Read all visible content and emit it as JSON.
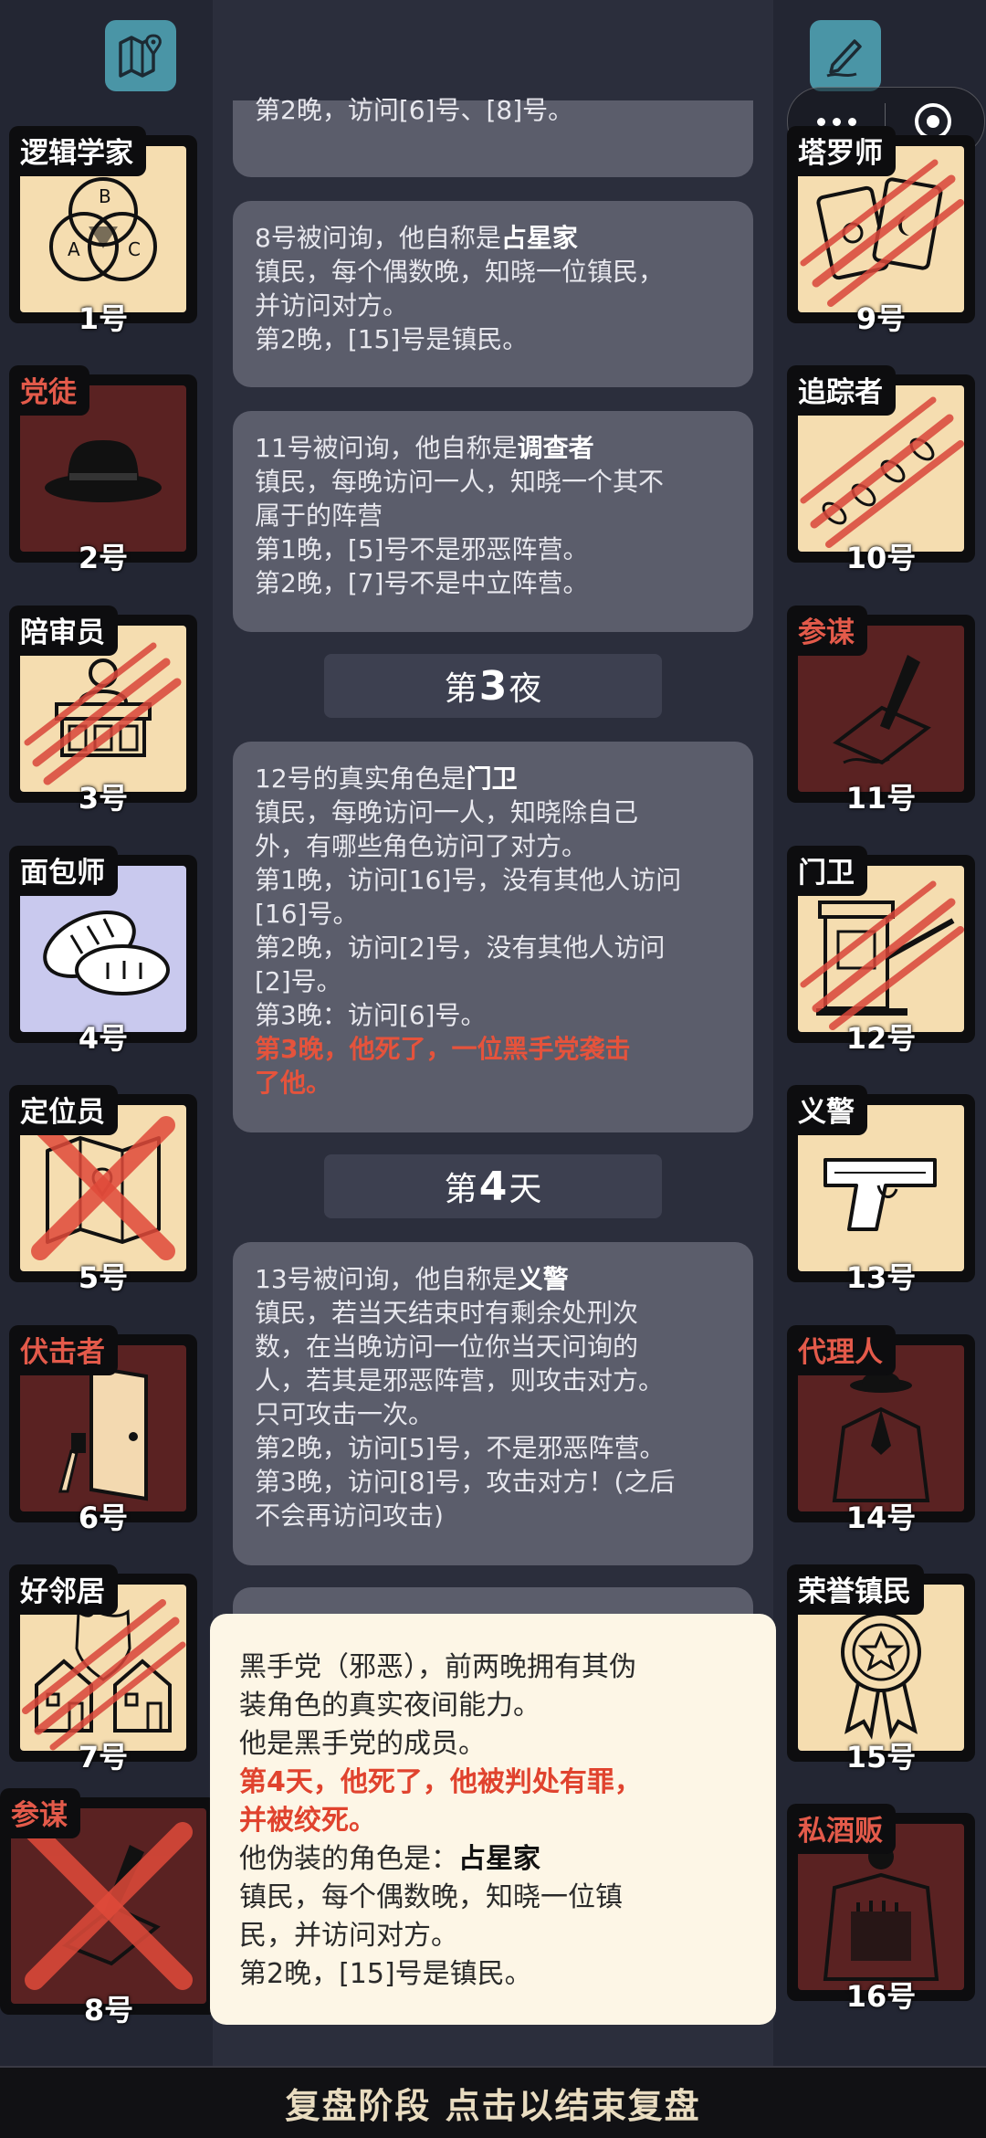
{
  "toolbar": {
    "map_icon": "map-pin-icon",
    "note_icon": "pen-icon"
  },
  "left_cards": [
    {
      "role": "逻辑学家",
      "num": "1号",
      "bg": "beige",
      "red_tag": false,
      "icon": "venn-diagram-icon",
      "mark": "none"
    },
    {
      "role": "党徒",
      "num": "2号",
      "bg": "dark",
      "red_tag": true,
      "icon": "fedora-hat-icon",
      "mark": "none"
    },
    {
      "role": "陪审员",
      "num": "3号",
      "bg": "beige",
      "red_tag": false,
      "icon": "jury-box-icon",
      "mark": "claw"
    },
    {
      "role": "面包师",
      "num": "4号",
      "bg": "lilac",
      "red_tag": false,
      "icon": "bread-icon",
      "mark": "none"
    },
    {
      "role": "定位员",
      "num": "5号",
      "bg": "beige",
      "red_tag": false,
      "icon": "map-icon",
      "mark": "cross"
    },
    {
      "role": "伏击者",
      "num": "6号",
      "bg": "dark",
      "red_tag": true,
      "icon": "door-knife-icon",
      "mark": "none"
    },
    {
      "role": "好邻居",
      "num": "7号",
      "bg": "beige",
      "red_tag": false,
      "icon": "houses-icon",
      "mark": "claw"
    }
  ],
  "right_cards": [
    {
      "role": "塔罗师",
      "num": "9号",
      "bg": "beige",
      "red_tag": false,
      "icon": "tarot-cards-icon",
      "mark": "claw"
    },
    {
      "role": "追踪者",
      "num": "10号",
      "bg": "beige",
      "red_tag": false,
      "icon": "footprints-icon",
      "mark": "claw"
    },
    {
      "role": "参谋",
      "num": "11号",
      "bg": "dark",
      "red_tag": true,
      "icon": "quill-pen-icon",
      "mark": "none"
    },
    {
      "role": "门卫",
      "num": "12号",
      "bg": "beige",
      "red_tag": false,
      "icon": "guard-booth-icon",
      "mark": "claw"
    },
    {
      "role": "义警",
      "num": "13号",
      "bg": "beige",
      "red_tag": false,
      "icon": "pistol-icon",
      "mark": "none"
    },
    {
      "role": "代理人",
      "num": "14号",
      "bg": "dark",
      "red_tag": true,
      "icon": "mobster-suit-icon",
      "mark": "none"
    },
    {
      "role": "荣誉镇民",
      "num": "15号",
      "bg": "beige",
      "red_tag": false,
      "icon": "medal-icon",
      "mark": "none"
    },
    {
      "role": "私酒贩",
      "num": "16号",
      "bg": "dark",
      "red_tag": true,
      "icon": "smuggler-coat-icon",
      "mark": "none"
    }
  ],
  "big_card": {
    "role": "参谋",
    "num": "8号",
    "icon": "quill-pen-icon",
    "mark": "cross"
  },
  "log": {
    "top_fragment": "第2晚，访问[6]号、[8]号。",
    "b1": {
      "pre": "8号被问询，他自称是",
      "role": "占星家",
      "l2": "镇民，每个偶数晚，知晓一位镇民，",
      "l3": "并访问对方。",
      "l4": "第2晚，[15]号是镇民。"
    },
    "b2": {
      "pre": "11号被问询，他自称是",
      "role": "调查者",
      "l2": "镇民，每晚访问一人，知晓一个其不",
      "l3": "属于的阵营",
      "l4": "第1晚，[5]号不是邪恶阵营。",
      "l5": "第2晚，[7]号不是中立阵营。"
    },
    "night3": {
      "pre": "第",
      "num": "3",
      "post": "夜"
    },
    "b3": {
      "pre": "12号的真实角色是",
      "role": "门卫",
      "l2": "镇民，每晚访问一人，知晓除自己",
      "l3": "外，有哪些角色访问了对方。",
      "l4": "第1晚，访问[16]号，没有其他人访问",
      "l5": "[16]号。",
      "l6": "第2晚，访问[2]号，没有其他人访问",
      "l7": "[2]号。",
      "l8": "第3晚：访问[6]号。",
      "r1": "第3晚，他死了，一位黑手党袭击",
      "r2": "了他。"
    },
    "day4": {
      "pre": "第",
      "num": "4",
      "post": "天"
    },
    "b4": {
      "pre": "13号被问询，他自称是",
      "role": "义警",
      "l2": "镇民，若当天结束时有剩余处刑次",
      "l3": "数，在当晚访问一位你当天问询的",
      "l4": "人，若其是邪恶阵营，则攻击对方。",
      "l5": "只可攻击一次。",
      "l6": "第2晚，访问[5]号，不是邪恶阵营。",
      "l7": "第3晚，访问[8]号，攻击对方！(之后",
      "l8": "不会再访问攻击)"
    }
  },
  "popup": {
    "l1": "黑手党（邪恶），前两晚拥有其伪",
    "l2": "装角色的真实夜间能力。",
    "l3": "他是黑手党的成员。",
    "r1": "第4天，他死了，他被判处有罪，",
    "r2": "并被绞死。",
    "l4pre": "他伪装的角色是：",
    "l4role": "占星家",
    "l5": "镇民，每个偶数晚，知晓一位镇",
    "l6": "民，并访问对方。",
    "l7": "第2晚，[15]号是镇民。"
  },
  "bottom_bar": "复盘阶段 点击以结束复盘"
}
